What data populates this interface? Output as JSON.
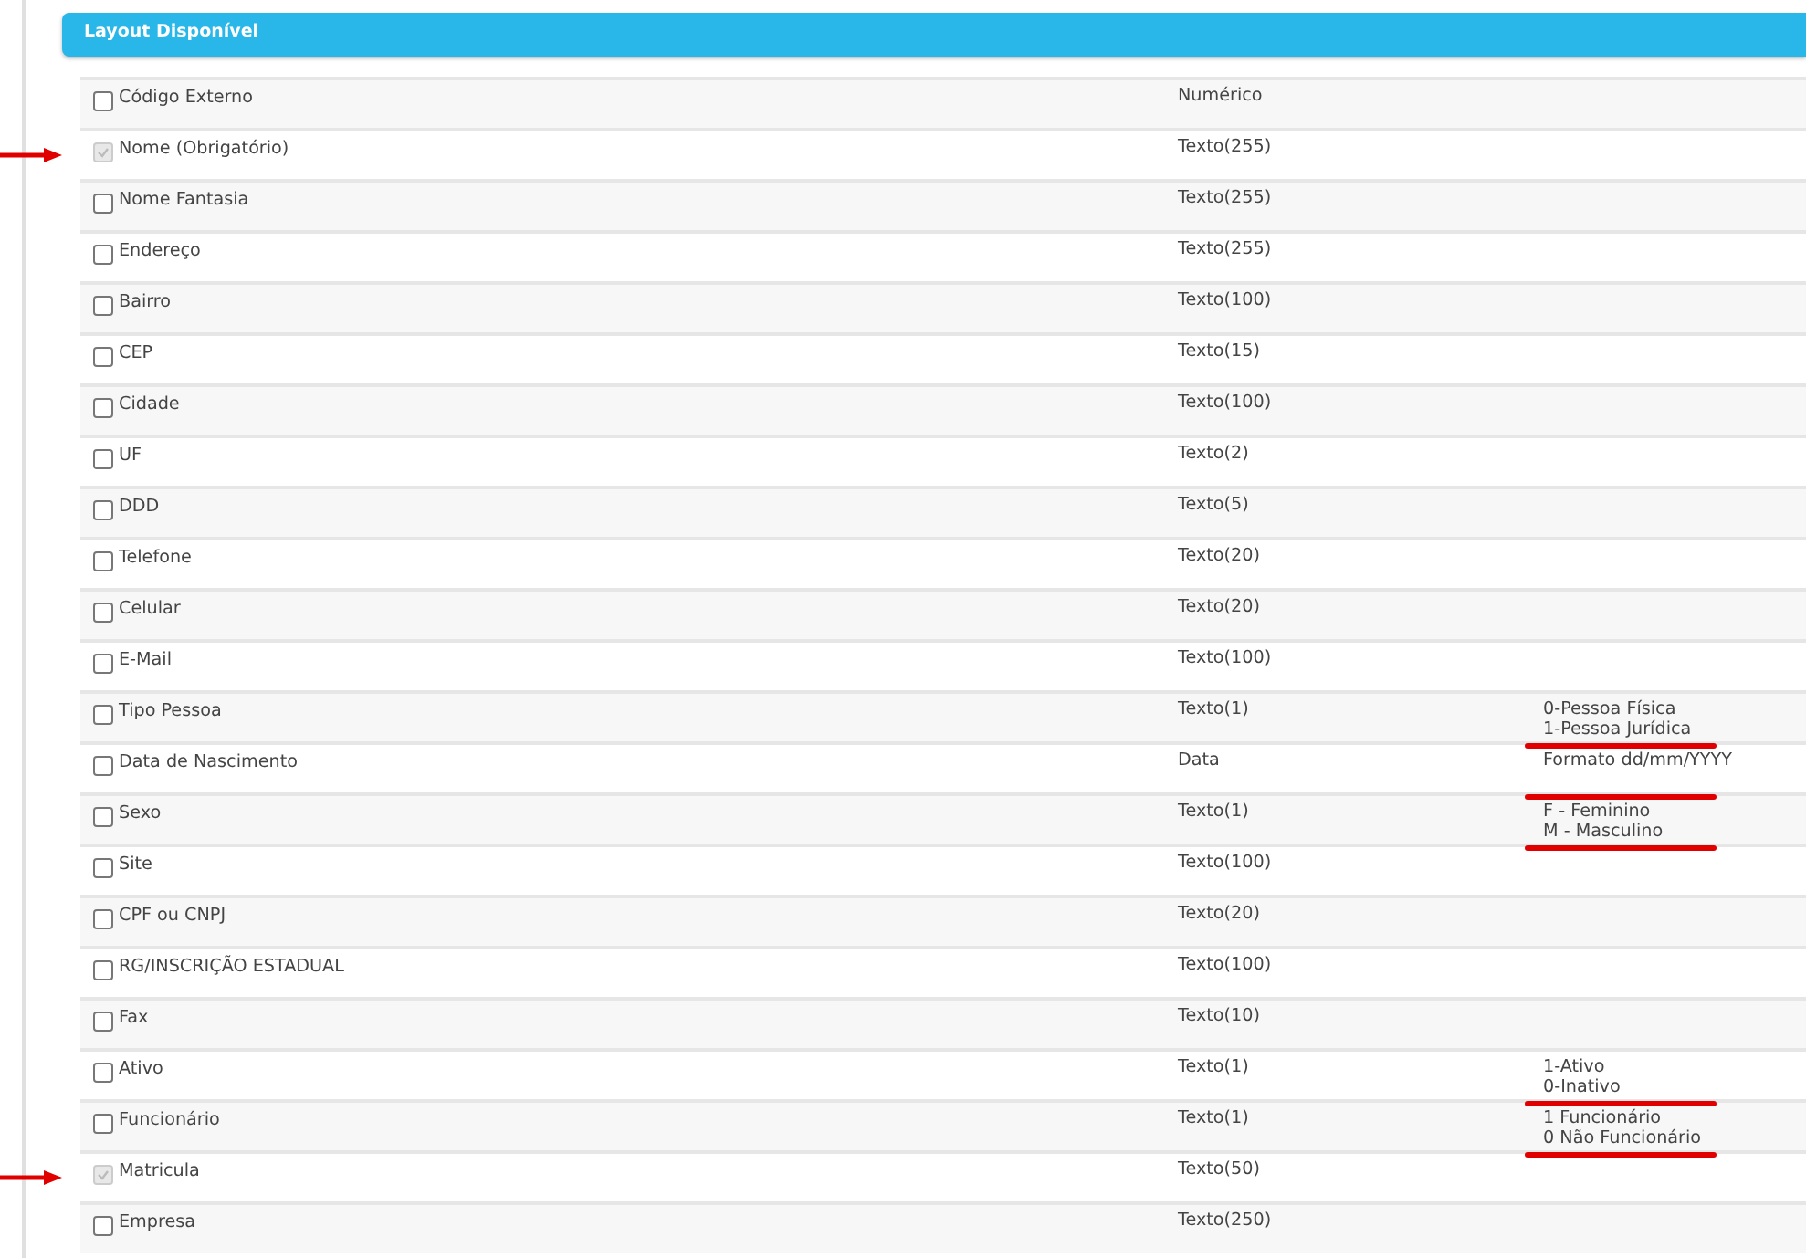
{
  "panel": {
    "title": "Layout Disponível"
  },
  "rows": [
    {
      "name": "Código Externo",
      "type": "Numérico",
      "checked": false,
      "disabled": false,
      "arrow": false
    },
    {
      "name": "Nome (Obrigatório)",
      "type": "Texto(255)",
      "checked": true,
      "disabled": true,
      "arrow": true
    },
    {
      "name": "Nome Fantasia",
      "type": "Texto(255)",
      "checked": false,
      "disabled": false,
      "arrow": false
    },
    {
      "name": "Endereço",
      "type": "Texto(255)",
      "checked": false,
      "disabled": false,
      "arrow": false
    },
    {
      "name": "Bairro",
      "type": "Texto(100)",
      "checked": false,
      "disabled": false,
      "arrow": false
    },
    {
      "name": "CEP",
      "type": "Texto(15)",
      "checked": false,
      "disabled": false,
      "arrow": false
    },
    {
      "name": "Cidade",
      "type": "Texto(100)",
      "checked": false,
      "disabled": false,
      "arrow": false
    },
    {
      "name": "UF",
      "type": "Texto(2)",
      "checked": false,
      "disabled": false,
      "arrow": false
    },
    {
      "name": "DDD",
      "type": "Texto(5)",
      "checked": false,
      "disabled": false,
      "arrow": false
    },
    {
      "name": "Telefone",
      "type": "Texto(20)",
      "checked": false,
      "disabled": false,
      "arrow": false
    },
    {
      "name": "Celular",
      "type": "Texto(20)",
      "checked": false,
      "disabled": false,
      "arrow": false
    },
    {
      "name": "E-Mail",
      "type": "Texto(100)",
      "checked": false,
      "disabled": false,
      "arrow": false
    },
    {
      "name": "Tipo Pessoa",
      "type": "Texto(1)",
      "note": "0-Pessoa Física\n1-Pessoa Jurídica",
      "checked": false,
      "disabled": false,
      "arrow": false
    },
    {
      "name": "Data de Nascimento",
      "type": "Data",
      "note": "Formato dd/mm/YYYY",
      "checked": false,
      "disabled": false,
      "arrow": false
    },
    {
      "name": "Sexo",
      "type": "Texto(1)",
      "note": "F - Feminino\nM - Masculino",
      "checked": false,
      "disabled": false,
      "arrow": false
    },
    {
      "name": "Site",
      "type": "Texto(100)",
      "checked": false,
      "disabled": false,
      "arrow": false
    },
    {
      "name": "CPF ou CNPJ",
      "type": "Texto(20)",
      "checked": false,
      "disabled": false,
      "arrow": false
    },
    {
      "name": "RG/INSCRIÇÃO ESTADUAL",
      "type": "Texto(100)",
      "checked": false,
      "disabled": false,
      "arrow": false
    },
    {
      "name": "Fax",
      "type": "Texto(10)",
      "checked": false,
      "disabled": false,
      "arrow": false
    },
    {
      "name": "Ativo",
      "type": "Texto(1)",
      "note": "1-Ativo\n0-Inativo",
      "checked": false,
      "disabled": false,
      "arrow": false
    },
    {
      "name": "Funcionário",
      "type": "Texto(1)",
      "note": "1 Funcionário\n0 Não Funcionário",
      "checked": false,
      "disabled": false,
      "arrow": false
    },
    {
      "name": "Matricula",
      "type": "Texto(50)",
      "checked": true,
      "disabled": true,
      "arrow": true
    },
    {
      "name": "Empresa",
      "type": "Texto(250)",
      "checked": false,
      "disabled": false,
      "arrow": false
    }
  ]
}
